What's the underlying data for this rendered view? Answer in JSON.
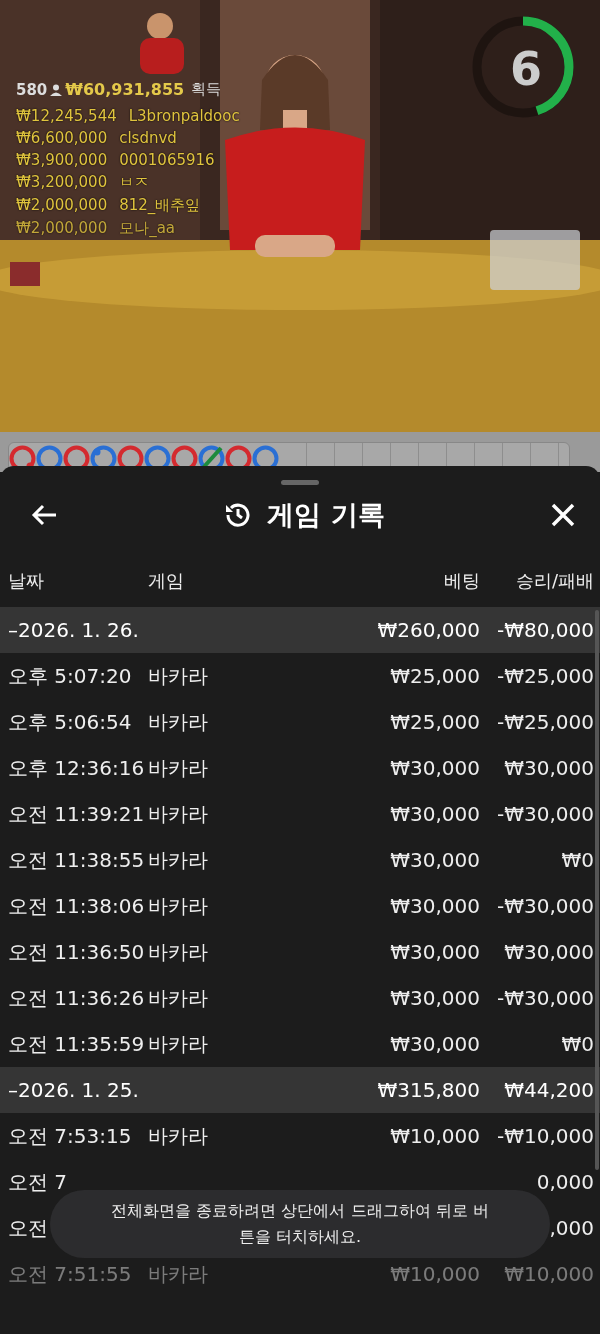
{
  "video": {
    "kind": "picture",
    "countdown": {
      "value": "6",
      "level": 0.45
    },
    "leaderboard": {
      "players": "580",
      "total": "₩60,931,855",
      "total_label": "획득",
      "winners": [
        {
          "amount": "₩12,245,544",
          "name": "L3bronpaldooc",
          "faded": false
        },
        {
          "amount": "₩6,600,000",
          "name": "clsdnvd",
          "faded": false
        },
        {
          "amount": "₩3,900,000",
          "name": "0001065916",
          "faded": false
        },
        {
          "amount": "₩3,200,000",
          "name": "ㅂㅈ",
          "faded": false
        },
        {
          "amount": "₩2,000,000",
          "name": "812_배추잎",
          "faded": false
        },
        {
          "amount": "₩2,000,000",
          "name": "모나_aa",
          "faded": true
        }
      ]
    }
  },
  "bead_road": [
    {
      "color": "#d42a2f",
      "kind": "dot-bottom"
    },
    {
      "color": "#2a6fd4",
      "kind": "plain"
    },
    {
      "color": "#d42a2f",
      "kind": "plain"
    },
    {
      "color": "#2a6fd4",
      "kind": "dot-top"
    },
    {
      "color": "#d42a2f",
      "kind": "plain"
    },
    {
      "color": "#2a6fd4",
      "kind": "plain"
    },
    {
      "color": "#d42a2f",
      "kind": "plain"
    },
    {
      "color": "#2a6fd4",
      "kind": "slash"
    },
    {
      "color": "#d42a2f",
      "kind": "plain"
    },
    {
      "color": "#2a6fd4",
      "kind": "plain"
    }
  ],
  "sheet": {
    "title": "게임 기록",
    "columns": [
      "날짜",
      "게임",
      "베팅",
      "승리/패배"
    ],
    "groups": [
      {
        "date": "–2026. 1. 26.",
        "bet": "₩260,000",
        "result": "-₩80,000",
        "rows": [
          {
            "time": "오후 5:07:20",
            "game": "바카라",
            "bet": "₩25,000",
            "result": "-₩25,000",
            "faded": false
          },
          {
            "time": "오후 5:06:54",
            "game": "바카라",
            "bet": "₩25,000",
            "result": "-₩25,000",
            "faded": false
          },
          {
            "time": "오후 12:36:16",
            "game": "바카라",
            "bet": "₩30,000",
            "result": "₩30,000",
            "faded": false
          },
          {
            "time": "오전 11:39:21",
            "game": "바카라",
            "bet": "₩30,000",
            "result": "-₩30,000",
            "faded": false
          },
          {
            "time": "오전 11:38:55",
            "game": "바카라",
            "bet": "₩30,000",
            "result": "₩0",
            "faded": false
          },
          {
            "time": "오전 11:38:06",
            "game": "바카라",
            "bet": "₩30,000",
            "result": "-₩30,000",
            "faded": false
          },
          {
            "time": "오전 11:36:50",
            "game": "바카라",
            "bet": "₩30,000",
            "result": "₩30,000",
            "faded": false
          },
          {
            "time": "오전 11:36:26",
            "game": "바카라",
            "bet": "₩30,000",
            "result": "-₩30,000",
            "faded": false
          },
          {
            "time": "오전 11:35:59",
            "game": "바카라",
            "bet": "₩30,000",
            "result": "₩0",
            "faded": false
          }
        ]
      },
      {
        "date": "–2026. 1. 25.",
        "bet": "₩315,800",
        "result": "₩44,200",
        "rows": [
          {
            "time": "오전 7:53:15",
            "game": "바카라",
            "bet": "₩10,000",
            "result": "-₩10,000",
            "faded": false
          },
          {
            "time": "오전 7",
            "result": "0,000",
            "faded": false
          },
          {
            "time": "오전",
            "result": ",000",
            "faded": false
          },
          {
            "time": "오전 7:51:55",
            "game": "바카라",
            "bet": "₩10,000",
            "result": "₩10,000",
            "faded": true
          }
        ]
      }
    ]
  },
  "toast": "전체화면을 종료하려면 상단에서 드래그하여 뒤로 버튼을 터치하세요."
}
